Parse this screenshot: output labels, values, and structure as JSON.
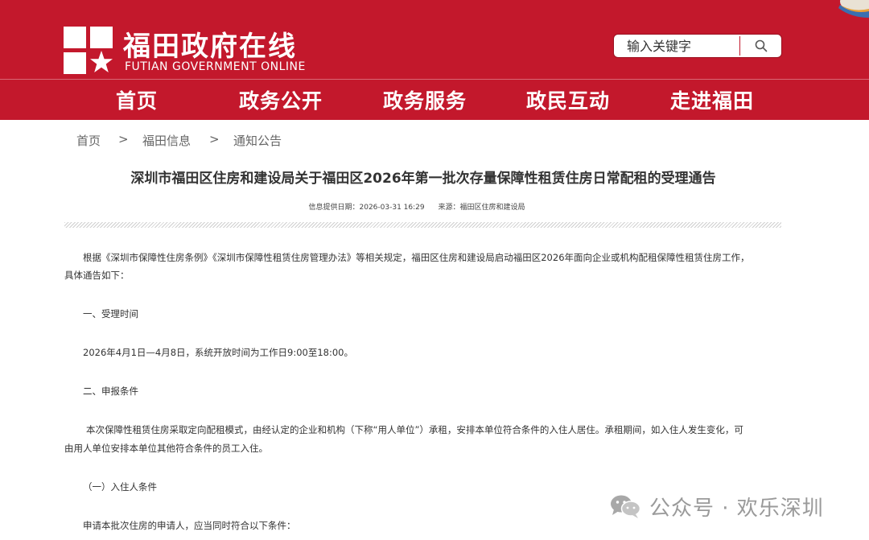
{
  "header": {
    "site_title": "福田政府在线",
    "site_subtitle": "FUTIAN GOVERNMENT ONLINE",
    "brand_color": "#c3182c",
    "logo_icon": "flag-star-logo-icon",
    "corner_icon": "decorative-corner-icon"
  },
  "search": {
    "placeholder": "输入关键字",
    "button_icon": "search-icon"
  },
  "nav": {
    "items": [
      {
        "label": "首页",
        "active": true
      },
      {
        "label": "政务公开",
        "active": false
      },
      {
        "label": "政务服务",
        "active": false
      },
      {
        "label": "政民互动",
        "active": false
      },
      {
        "label": "走进福田",
        "active": false
      }
    ]
  },
  "breadcrumb": {
    "items": [
      "首页",
      "福田信息",
      "通知公告"
    ],
    "separator": ">"
  },
  "article": {
    "title": "深圳市福田区住房和建设局关于福田区2026年第一批次存量保障性租赁住房日常配租的受理通告",
    "meta_date": "信息提供日期：2026-03-31 16:29",
    "meta_source": "来源：福田区住房和建设局",
    "paragraphs": [
      "根据《深圳市保障性住房条例》《深圳市保障性租赁住房管理办法》等相关规定，福田区住房和建设局启动福田区2026年面向企业或机构配租保障性租赁住房工作，",
      "具体通告如下：",
      "一、受理时间",
      "2026年4月1日—4月8日，系统开放时间为工作日9:00至18:00。",
      "二、申报条件",
      "本次保障性租赁住房采取定向配租模式，由经认定的企业和机构（下称“用人单位”）承租，安排本单位符合条件的入住人居住。承租期间，如入住人发生变化，可",
      "由用人单位安排本单位其他符合条件的员工入住。",
      "（一）入住人条件",
      "申请本批次住房的申请人，应当同时符合以下条件："
    ]
  },
  "watermark": {
    "text": "公众号 · 欢乐深圳",
    "icon": "wechat-icon"
  }
}
